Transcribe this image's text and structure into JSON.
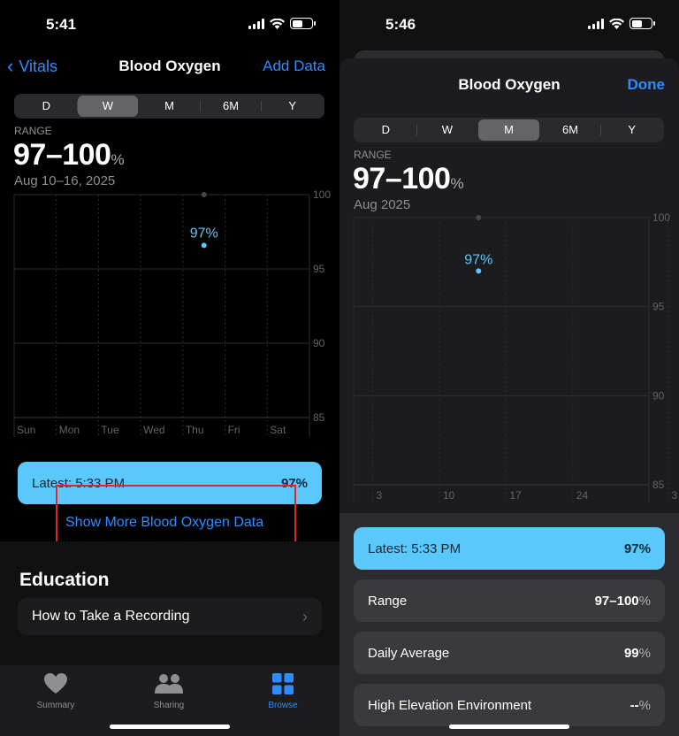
{
  "left": {
    "status_time": "5:41",
    "nav": {
      "back_label": "Vitals",
      "title": "Blood Oxygen",
      "add_label": "Add Data"
    },
    "segments": [
      "D",
      "W",
      "M",
      "6M",
      "Y"
    ],
    "selected_segment": "W",
    "range_label": "RANGE",
    "range_value": "97–100",
    "range_unit": "%",
    "date_range": "Aug 10–16, 2025",
    "latest": {
      "label": "Latest: 5:33 PM",
      "value": "97%"
    },
    "show_more_label": "Show More Blood Oxygen Data",
    "education": {
      "heading": "Education",
      "row_label": "How to Take a Recording"
    },
    "tabs": [
      {
        "label": "Summary",
        "icon": "heart-icon"
      },
      {
        "label": "Sharing",
        "icon": "people-icon"
      },
      {
        "label": "Browse",
        "icon": "grid-icon"
      }
    ],
    "active_tab": "Browse"
  },
  "right": {
    "status_time": "5:46",
    "title": "Blood Oxygen",
    "done_label": "Done",
    "segments": [
      "D",
      "W",
      "M",
      "6M",
      "Y"
    ],
    "selected_segment": "M",
    "range_label": "RANGE",
    "range_value": "97–100",
    "range_unit": "%",
    "date_range": "Aug 2025",
    "latest": {
      "label": "Latest: 5:33 PM",
      "value": "97%"
    },
    "rows": [
      {
        "label": "Range",
        "value": "97–100",
        "unit": "%"
      },
      {
        "label": "Daily Average",
        "value": "99",
        "unit": "%"
      },
      {
        "label": "High Elevation Environment",
        "value": "--",
        "unit": "%"
      }
    ]
  },
  "colors": {
    "accent": "#2d8cff",
    "data": "#5ac8fa",
    "annotation": "#e0242b"
  },
  "chart_data": [
    {
      "type": "scatter",
      "categories": [
        "Sun",
        "Mon",
        "Tue",
        "Wed",
        "Thu",
        "Fri",
        "Sat"
      ],
      "ylim": [
        85,
        100
      ],
      "yticks": [
        100,
        95,
        90,
        85
      ],
      "series": [
        {
          "points": [
            {
              "x": "Thu",
              "y": 97
            }
          ]
        },
        {
          "points": [
            {
              "x": "Thu",
              "y": 100
            }
          ]
        }
      ],
      "annotation": "97%",
      "grid": true
    },
    {
      "type": "scatter",
      "xticks": [
        "3",
        "10",
        "17",
        "24",
        "3"
      ],
      "ylim": [
        85,
        100
      ],
      "yticks": [
        100,
        95,
        90,
        85
      ],
      "series": [
        {
          "points": [
            {
              "x": 13,
              "y": 97
            }
          ]
        },
        {
          "points": [
            {
              "x": 13,
              "y": 100
            }
          ]
        }
      ],
      "annotation": "97%",
      "grid": true
    }
  ]
}
